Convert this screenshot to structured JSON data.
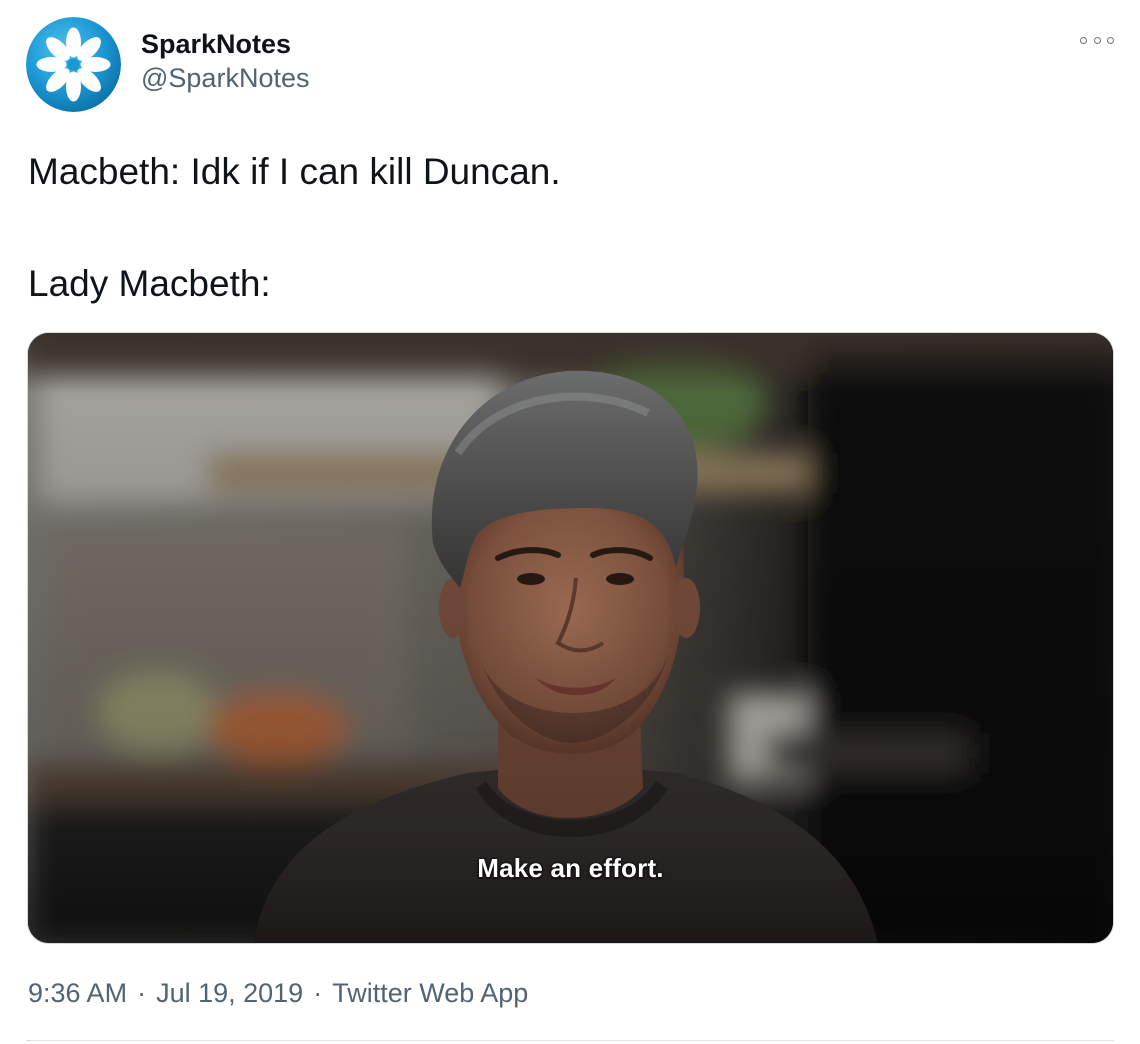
{
  "author": {
    "display_name": "SparkNotes",
    "handle": "@SparkNotes",
    "avatar_icon": "sparknotes-flower-logo",
    "avatar_color": "#1b97d4"
  },
  "more_icon": "more-options-icon",
  "tweet": {
    "line1": "Macbeth: Idk if I can kill Duncan.",
    "line2": "Lady Macbeth:"
  },
  "media": {
    "subtitle": "Make an effort."
  },
  "meta": {
    "time": "9:36 AM",
    "separator": "·",
    "date": "Jul 19, 2019",
    "source": "Twitter Web App"
  }
}
